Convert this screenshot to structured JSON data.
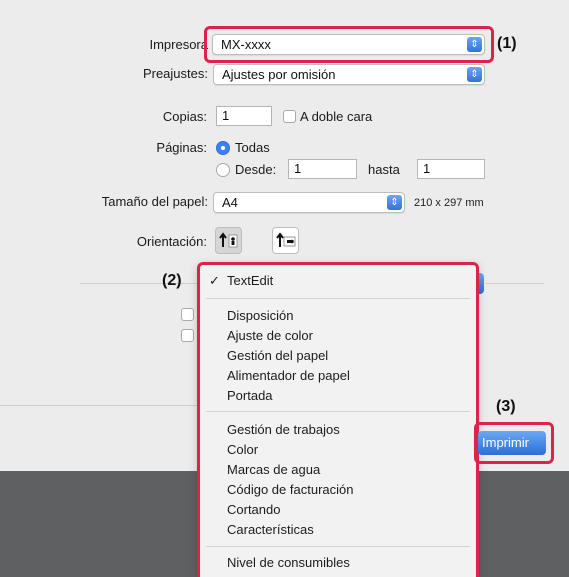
{
  "dialog": {
    "printer_label": "Impresora",
    "printer_value": "MX-xxxx",
    "presets_label": "Preajustes:",
    "presets_value": "Ajustes por omisión",
    "copies_label": "Copias:",
    "copies_value": "1",
    "duplex_label": "A doble cara",
    "pages_label": "Páginas:",
    "pages_all": "Todas",
    "pages_from": "Desde:",
    "pages_from_value": "1",
    "pages_to": "hasta",
    "pages_to_value": "1",
    "paper_label": "Tamaño del papel:",
    "paper_value": "A4",
    "paper_dims": "210 x 297 mm",
    "orientation_label": "Orientación:",
    "print_button": "Imprimir"
  },
  "menu": {
    "checked_item": "TextEdit",
    "group1": [
      "Disposición",
      "Ajuste de color",
      "Gestión del papel",
      "Alimentador de papel",
      "Portada"
    ],
    "group2": [
      "Gestión de trabajos",
      "Color",
      "Marcas de agua",
      "Código de facturación",
      "Cortando",
      "Características"
    ],
    "group3": [
      "Nivel de consumibles"
    ]
  },
  "callouts": {
    "c1": "(1)",
    "c2": "(2)",
    "c3": "(3)"
  },
  "colors": {
    "highlight": "#d9254a",
    "accent_blue": "#3b82ef"
  }
}
